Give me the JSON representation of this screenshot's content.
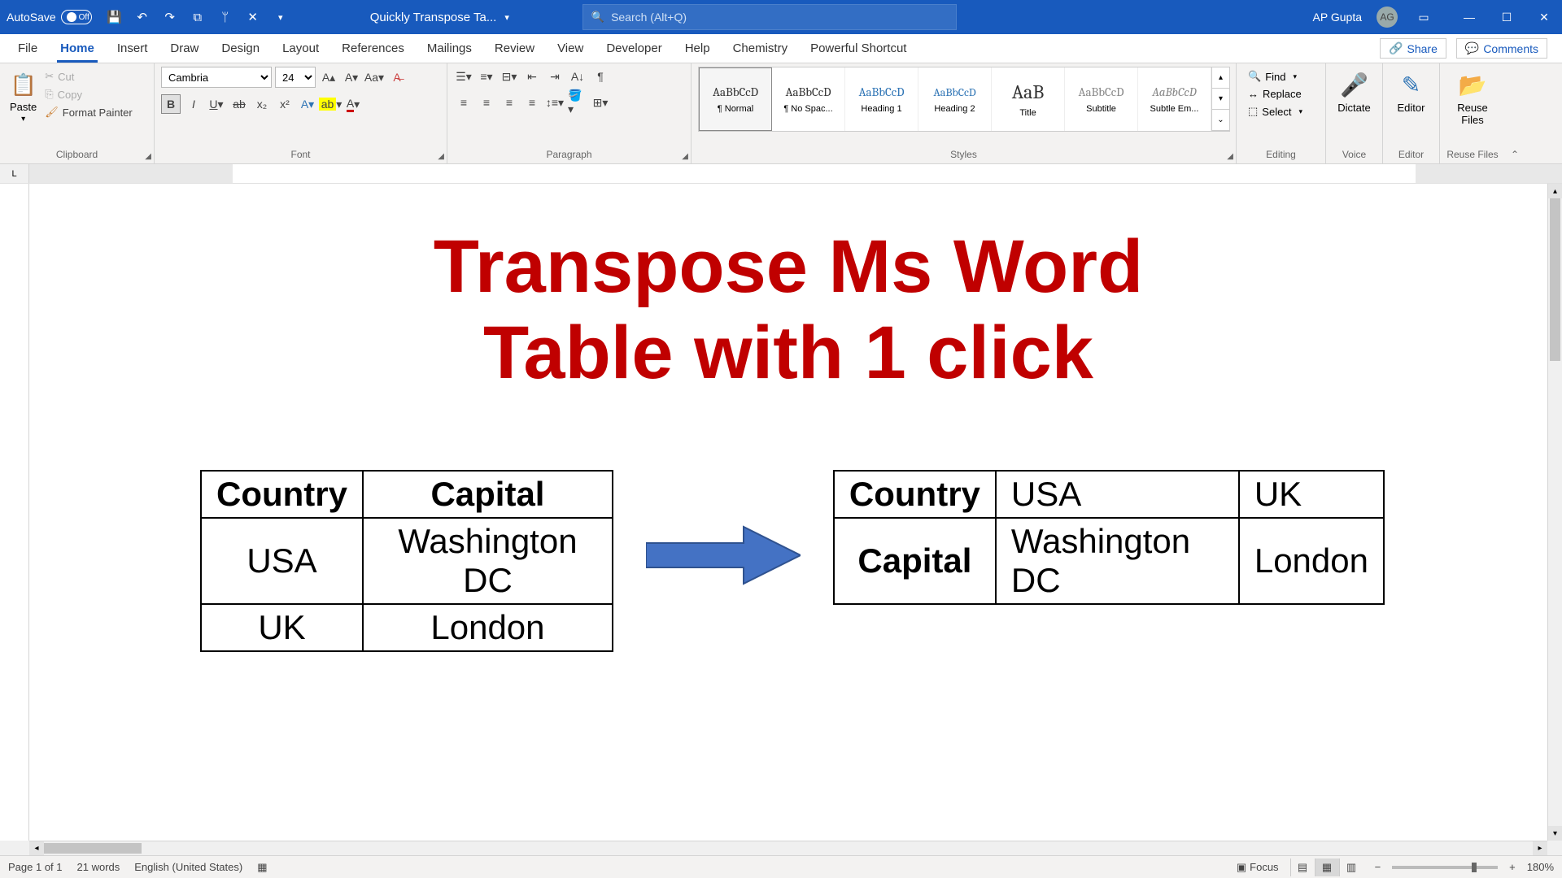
{
  "titlebar": {
    "autosave_label": "AutoSave",
    "autosave_state": "Off",
    "doc_name": "Quickly Transpose Ta...",
    "search_placeholder": "Search (Alt+Q)",
    "user_name": "AP Gupta",
    "user_initials": "AG"
  },
  "tabs": {
    "file": "File",
    "home": "Home",
    "insert": "Insert",
    "draw": "Draw",
    "design": "Design",
    "layout": "Layout",
    "references": "References",
    "mailings": "Mailings",
    "review": "Review",
    "view": "View",
    "developer": "Developer",
    "help": "Help",
    "chemistry": "Chemistry",
    "powerful": "Powerful Shortcut",
    "share": "Share",
    "comments": "Comments"
  },
  "ribbon": {
    "clipboard": {
      "paste": "Paste",
      "cut": "Cut",
      "copy": "Copy",
      "format_painter": "Format Painter",
      "group": "Clipboard"
    },
    "font": {
      "name": "Cambria",
      "size": "24",
      "group": "Font"
    },
    "paragraph": {
      "group": "Paragraph"
    },
    "styles": {
      "normal": "¶ Normal",
      "nospac": "¶ No Spac...",
      "h1": "Heading 1",
      "h2": "Heading 2",
      "title": "Title",
      "subtitle": "Subtitle",
      "subem": "Subtle Em...",
      "preview": "AaBbCcD",
      "preview_title": "AaB",
      "group": "Styles"
    },
    "editing": {
      "find": "Find",
      "replace": "Replace",
      "select": "Select",
      "group": "Editing"
    },
    "voice": {
      "dictate": "Dictate",
      "group": "Voice"
    },
    "editor": {
      "label": "Editor",
      "group": "Editor"
    },
    "reuse": {
      "label": "Reuse Files",
      "group": "Reuse Files"
    }
  },
  "document": {
    "title_line1": "Transpose Ms Word",
    "title_line2": "Table with 1 click",
    "table1": {
      "header": [
        "Country",
        "Capital"
      ],
      "rows": [
        [
          "USA",
          "Washington DC"
        ],
        [
          "UK",
          "London"
        ]
      ]
    },
    "table2": {
      "rows": [
        [
          "Country",
          "USA",
          "UK"
        ],
        [
          "Capital",
          "Washington DC",
          "London"
        ]
      ]
    }
  },
  "statusbar": {
    "page": "Page 1 of 1",
    "words": "21 words",
    "lang": "English (United States)",
    "focus": "Focus",
    "zoom": "180%"
  }
}
